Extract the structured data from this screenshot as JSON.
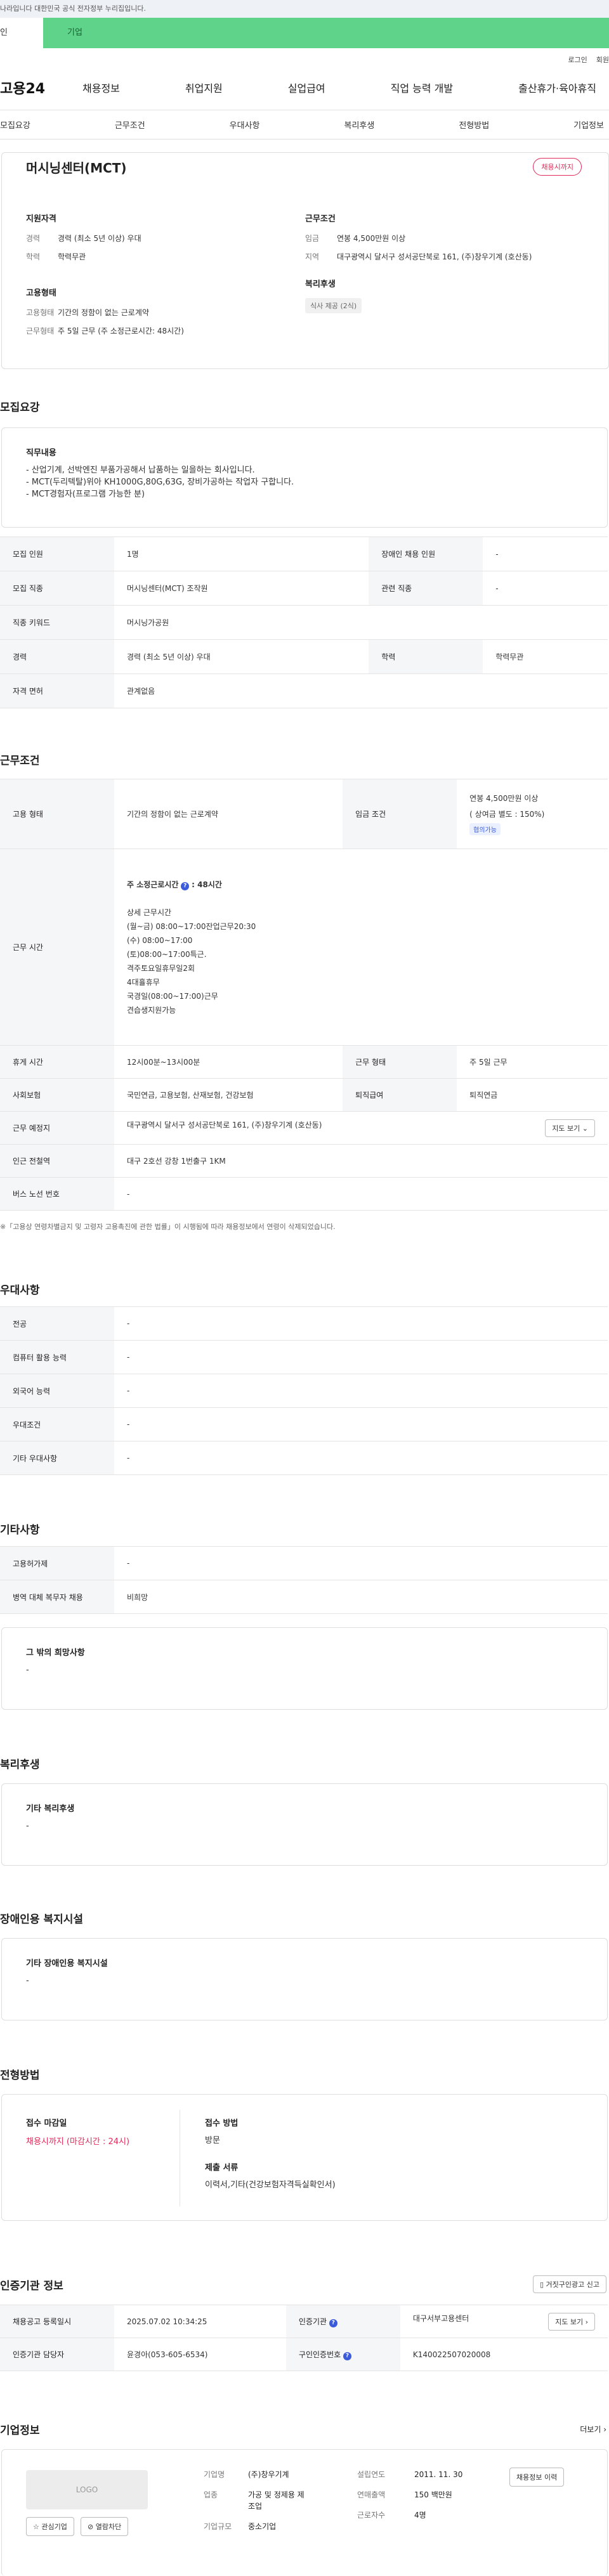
{
  "gov": {
    "text": "나라입니다 대한민국 공식 전자정부 누리집입니다."
  },
  "tabs": {
    "t1": "인",
    "t2": "기업"
  },
  "util": {
    "login": "로그인",
    "join": "회원"
  },
  "header": {
    "logo": "고용24",
    "menu": [
      "채용정보",
      "취업지원",
      "실업급여",
      "직업 능력 개발",
      "출산휴가·육아휴직"
    ]
  },
  "lnb": [
    "모집요강",
    "근무조건",
    "우대사항",
    "복리후생",
    "전형방법",
    "기업정보"
  ],
  "job": {
    "title": "머시닝센터(MCT)",
    "badge": "채용시까지",
    "qual_h": "지원자격",
    "career_k": "경력",
    "career_v": "경력 (최소 5년 이상) 우대",
    "edu_k": "학력",
    "edu_v": "학력무관",
    "emp_h": "고용형태",
    "type_k": "고용형태",
    "type_v": "기간의 정함이 없는 근로계약",
    "work_k": "근무형태",
    "work_v": "주 5일 근무 (주 소정근로시간: 48시간)",
    "cond_h": "근무조건",
    "wage_k": "임금",
    "wage_v": "연봉 4,500만원 이상",
    "area_k": "지역",
    "area_v": "대구광역시 달서구 성서공단북로 161, (주)창우기계 (호산동)",
    "welfare_h": "복리후생",
    "welfare_chip": "식사 제공 (2식)"
  },
  "recruit": {
    "section": "모집요강",
    "duty_h": "직무내용",
    "duty": [
      "- 산업기계, 선박엔진 부품가공해서 납품하는 일을하는 회사입니다.",
      "- MCT(두리텍탈)위아 KH1000G,80G,63G, 장비가공하는 작업자 구합니다.",
      "- MCT경험자(프로그램 가능한 분)"
    ],
    "rows": [
      [
        "모집 인원",
        "1명",
        "장애인 채용 인원",
        "-"
      ],
      [
        "모집 직종",
        "머시닝센터(MCT) 조작원",
        "관련 직종",
        "-"
      ],
      [
        "직종 키워드",
        "머시닝가공원",
        "",
        ""
      ],
      [
        "경력",
        "경력 (최소 5년 이상) 우대",
        "학력",
        "학력무관"
      ],
      [
        "자격 면허",
        "관계없음",
        "",
        ""
      ]
    ]
  },
  "work": {
    "section": "근무조건",
    "type_k": "고용 형태",
    "type_v": "기간의 정함이 없는 근로계약",
    "wage_k": "임금 조건",
    "wage_v": "연봉 4,500만원 이상",
    "wage_sub": "( 상여금 별도 : 150%)",
    "wage_tag": "협의가능",
    "hours_k": "근무 시간",
    "hours_main": "주 소정근로시간",
    "hours_val": ": 48시간",
    "hours_detail_h": "상세 근무시간",
    "hours_detail": [
      "(월~금) 08:00~17:00잔업근무20:30",
      "(수) 08:00~17:00",
      "(토)08:00~17:00특근.",
      "격주토요일휴무일2회",
      "4대휼휴무",
      "국경일(08:00~17:00)근무",
      "견습생지원가능"
    ],
    "rest_k": "휴게 시간",
    "rest_v": "12시00분~13시00분",
    "form_k": "근무 형태",
    "form_v": "주 5일 근무",
    "ins_k": "사회보험",
    "ins_v": "국민연금, 고용보험, 산재보험, 건강보험",
    "ret_k": "퇴직급여",
    "ret_v": "퇴직연금",
    "loc_k": "근무 예정지",
    "loc_v": "대구광역시 달서구 성서공단북로 161, (주)창우기계 (호산동)",
    "map_btn": "지도 보기",
    "sub_k": "인근 전철역",
    "sub_v": "대구 2호선 강창 1번출구 1KM",
    "bus_k": "버스 노선 번호",
    "bus_v": "-",
    "note": "※「고용상 연령차별금지 및 고령자 고용촉진에 관한 법률」이 시행됨에 따라 채용정보에서 연령이 삭제되었습니다."
  },
  "pref": {
    "section": "우대사항",
    "rows": [
      [
        "전공",
        "-"
      ],
      [
        "컴퓨터 활용 능력",
        "-"
      ],
      [
        "외국어 능력",
        "-"
      ],
      [
        "우대조건",
        "-"
      ],
      [
        "기타 우대사항",
        "-"
      ]
    ]
  },
  "etc": {
    "section": "기타사항",
    "rows": [
      [
        "고용허가제",
        "-"
      ],
      [
        "병역 대체 복무자 채용",
        "비희망"
      ]
    ],
    "other_h": "그 밖의 희망사항",
    "other_v": "-"
  },
  "welfare": {
    "section": "복리후생",
    "h": "기타 복리후생",
    "v": "-"
  },
  "disab": {
    "section": "장애인용 복지시설",
    "h": "기타 장애인용 복지시설",
    "v": "-"
  },
  "select": {
    "section": "전형방법",
    "deadline_h": "접수 마감일",
    "deadline_v": "채용시까지 (마감시간 : 24시)",
    "method_h": "접수 방법",
    "method_v": "방문",
    "docs_h": "제출 서류",
    "docs_v": "이력서,기타(건강보험자격득실확인서)"
  },
  "cert": {
    "section": "인증기관 정보",
    "report_btn": "거짓구인광고 신고",
    "reg_k": "채용공고 등록일시",
    "reg_v": "2025.07.02 10:34:25",
    "org_k": "인증기관",
    "org_v": "대구서부고용센터",
    "map_btn": "지도 보기",
    "mgr_k": "인증기관 담당자",
    "mgr_v": "윤경아(053-605-6534)",
    "no_k": "구인인증번호",
    "no_v": "K140022507020008"
  },
  "company": {
    "section": "기업정보",
    "more": "더보기",
    "logo": "LOGO",
    "fav": "관심기업",
    "block": "열람차단",
    "name_k": "기업명",
    "name_v": "(주)창우기계",
    "year_k": "설립연도",
    "year_v": "2011. 11. 30",
    "ind_k": "업종",
    "ind_v": "가공 및 정제용 제조업",
    "sales_k": "연매출액",
    "sales_v": "150 백만원",
    "size_k": "기업규모",
    "size_v": "중소기업",
    "emp_k": "근로자수",
    "emp_v": "4명",
    "jobs_btn": "채용정보 이력"
  }
}
